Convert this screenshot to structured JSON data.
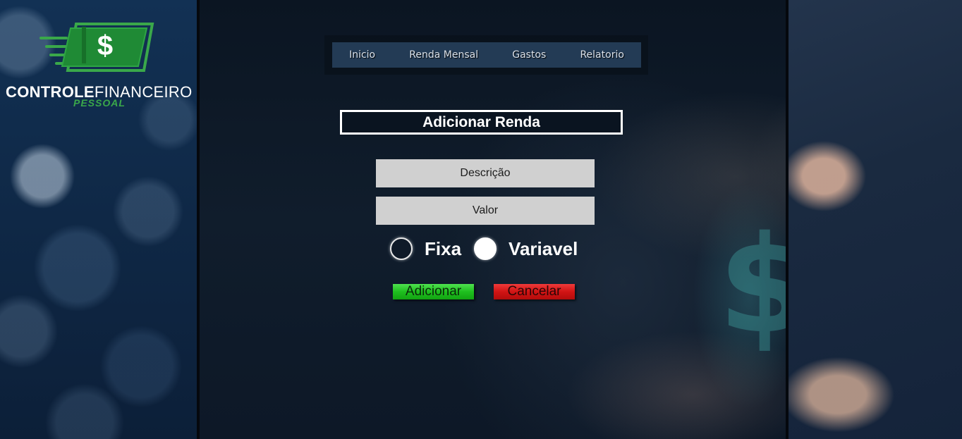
{
  "logo": {
    "mark_symbol": "$",
    "title_strong": "CONTROLE",
    "title_light": "FINANCEIRO",
    "subtitle": "PESSOAL"
  },
  "nav": {
    "items": [
      "Inicio",
      "Renda Mensal",
      "Gastos",
      "Relatorio"
    ]
  },
  "form": {
    "title": "Adicionar Renda",
    "descricao_placeholder": "Descrição",
    "valor_placeholder": "Valor",
    "radio_options": [
      {
        "label": "Fixa",
        "selected": false
      },
      {
        "label": "Variavel",
        "selected": true
      }
    ],
    "add_label": "Adicionar",
    "cancel_label": "Cancelar"
  },
  "background": {
    "right_symbol": "$"
  },
  "colors": {
    "accent_green": "#1fbf1f",
    "accent_red": "#d11414",
    "nav_bg": "#233b55",
    "logo_green": "#3aa84a"
  }
}
